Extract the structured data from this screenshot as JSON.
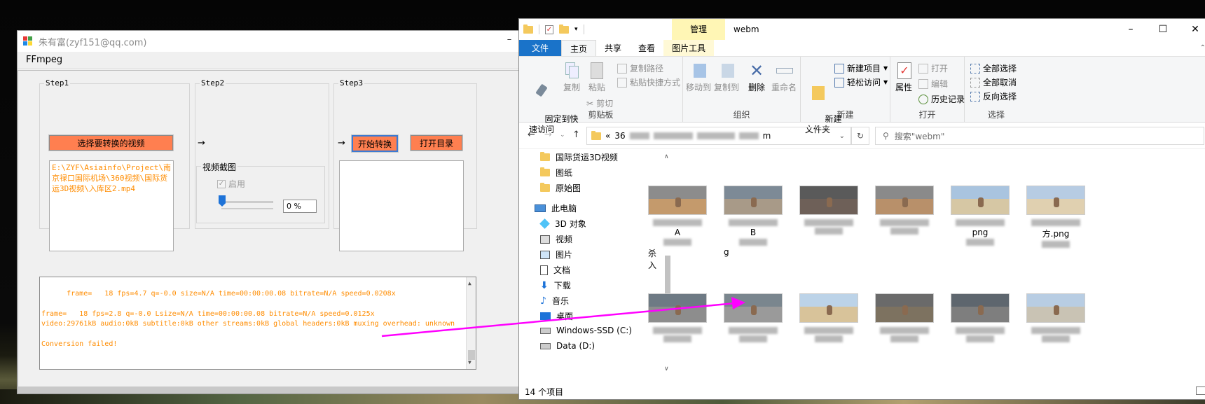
{
  "app": {
    "title": "朱有富(zyf151@qq.com)",
    "menu": [
      "FFmpeg"
    ],
    "step1": {
      "label": "Step1",
      "button": "选择要转换的视频",
      "path": "E:\\ZYF\\Asiainfo\\Project\\南京禄口国际机场\\360视频\\国际货运3D视频\\入库区2.mp4"
    },
    "step2": {
      "label": "Step2",
      "arrow": "→",
      "group": "视频截图",
      "enable_label": "启用",
      "percent": "0 %",
      "slider_value": 0
    },
    "step3": {
      "label": "Step3",
      "arrow": "→",
      "start_button": "开始转换",
      "open_button": "打开目录"
    },
    "log": "frame=   18 fps=4.7 q=-0.0 size=N/A time=00:00:00.08 bitrate=N/A speed=0.0208x\n\nframe=   18 fps=2.8 q=-0.0 Lsize=N/A time=00:00:00.08 bitrate=N/A speed=0.0125x\nvideo:29761kB audio:0kB subtitle:0kB other streams:0kB global headers:0kB muxing overhead: unknown\n\nConversion failed!"
  },
  "explorer": {
    "context_tab": "管理",
    "title": "webm",
    "tabs": [
      "文件",
      "主页",
      "共享",
      "查看",
      "图片工具"
    ],
    "ribbon": {
      "clipboard": {
        "label": "剪贴板",
        "pin": "固定到快\n速访问",
        "copy": "复制",
        "paste": "粘贴",
        "copy_path": "复制路径",
        "paste_shortcut": "粘贴快捷方式",
        "cut": "剪切"
      },
      "organize": {
        "label": "组织",
        "move_to": "移动到",
        "copy_to": "复制到",
        "delete": "删除",
        "rename": "重命名"
      },
      "new": {
        "label": "新建",
        "new_folder": "新建\n文件夹",
        "new_item": "新建项目",
        "easy_access": "轻松访问"
      },
      "open": {
        "label": "打开",
        "properties": "属性",
        "open": "打开",
        "edit": "编辑",
        "history": "历史记录"
      },
      "select": {
        "label": "选择",
        "select_all": "全部选择",
        "select_none": "全部取消",
        "invert": "反向选择"
      }
    },
    "address": {
      "prefix": "«",
      "visible_start": "36",
      "visible_end": "m"
    },
    "search_placeholder": "搜索\"webm\"",
    "nav": [
      "国际货运3D视频",
      "图纸",
      "原始图",
      "此电脑",
      "3D 对象",
      "视频",
      "图片",
      "文档",
      "下载",
      "音乐",
      "桌面",
      "Windows-SSD (C:)",
      "Data (D:)"
    ],
    "files_row1": [
      {
        "caption_visible": "A",
        "caption_tail": "杀",
        "caption_tail2": "入"
      },
      {
        "caption_visible": "B",
        "caption_tail": "g"
      },
      {
        "caption_visible": ""
      },
      {
        "caption_visible": ""
      },
      {
        "caption_visible": "png"
      },
      {
        "caption_visible": "方.png"
      }
    ],
    "files_row2": [
      {
        "caption_visible": ""
      },
      {
        "caption_visible": ""
      },
      {
        "caption_visible": ""
      },
      {
        "caption_visible": ""
      },
      {
        "caption_visible": ""
      },
      {
        "caption_visible": ""
      }
    ],
    "status": "14 个项目"
  },
  "colors": {
    "accent_orange": "#ff7f50",
    "log_text": "#ff8c00",
    "file_tab": "#1a73c9",
    "context_tab": "#fff6b5",
    "annotation": "#ff00ff"
  }
}
